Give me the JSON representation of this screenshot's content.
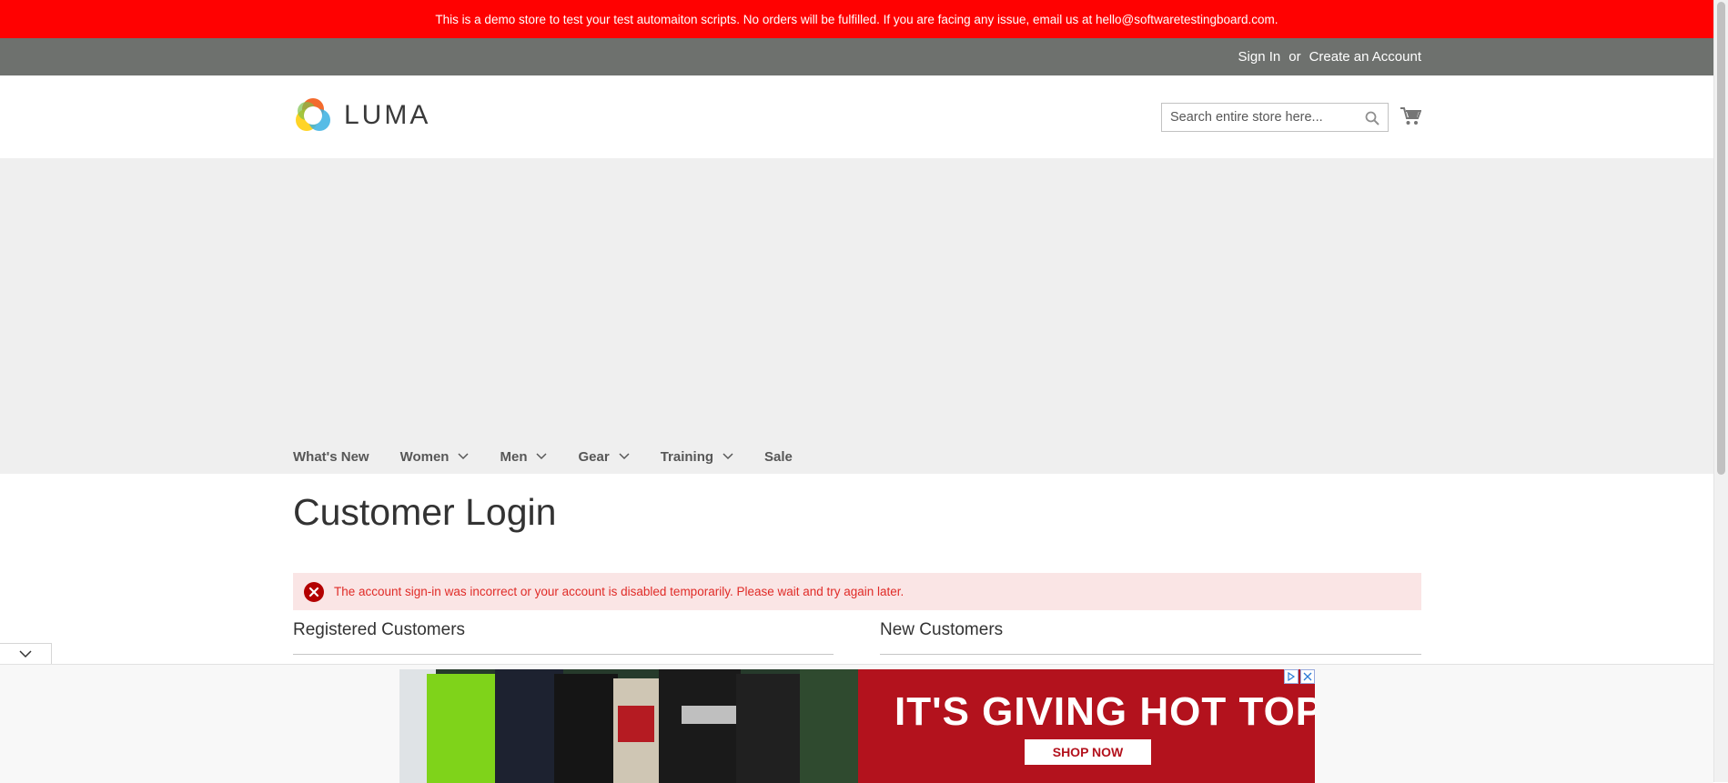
{
  "demo_banner": "This is a demo store to test your test automaiton scripts. No orders will be fulfilled. If you are facing any issue, email us at hello@softwaretestingboard.com.",
  "header_links": {
    "sign_in": "Sign In",
    "or": "or",
    "create_account": "Create an Account"
  },
  "logo": {
    "text": "LUMA",
    "icon": "luma-logo-icon"
  },
  "search": {
    "placeholder": "Search entire store here...",
    "icon": "search-icon"
  },
  "cart": {
    "icon": "cart-icon"
  },
  "nav": {
    "whats_new": "What's New",
    "women": "Women",
    "men": "Men",
    "gear": "Gear",
    "training": "Training",
    "sale": "Sale"
  },
  "page": {
    "title": "Customer Login",
    "error": "The account sign-in was incorrect or your account is disabled temporarily. Please wait and try again later.",
    "registered_title": "Registered Customers",
    "new_title": "New Customers"
  },
  "ad": {
    "headline": "IT'S GIVING HOT TOPIC",
    "cta": "SHOP NOW"
  },
  "colors": {
    "banner": "#ff0101",
    "header_bar": "#6e716e",
    "error_bg": "#fae5e5",
    "error_text": "#e02b27",
    "ad_red": "#b3121d"
  }
}
